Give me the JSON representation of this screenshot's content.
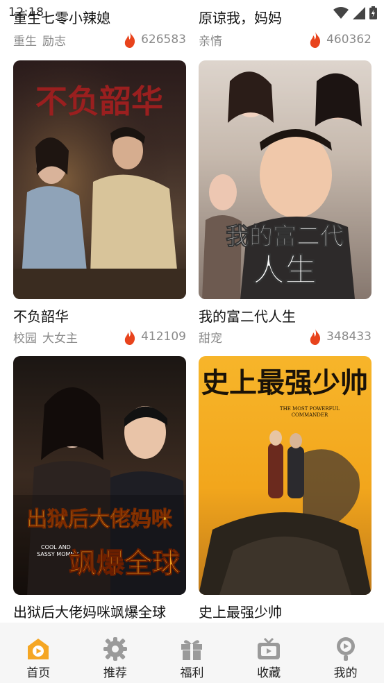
{
  "status": {
    "time": "12:18"
  },
  "cards": [
    {
      "title": "重生七零小辣媳",
      "tags": [
        "重生",
        "励志"
      ],
      "views": "626583"
    },
    {
      "title": "原谅我，妈妈",
      "tags": [
        "亲情"
      ],
      "views": "460362"
    },
    {
      "title": "不负韶华",
      "tags": [
        "校园",
        "大女主"
      ],
      "views": "412109",
      "poster_text": "不负韶华"
    },
    {
      "title": "我的富二代人生",
      "tags": [
        "甜宠"
      ],
      "views": "348433",
      "poster_text_1": "我的富二代",
      "poster_text_2": "人生"
    },
    {
      "title": "出狱后大佬妈咪飒爆全球",
      "poster_text_1": "出狱后大佬妈咪",
      "poster_text_2": "飒爆全球",
      "poster_en_1": "COOL AND",
      "poster_en_2": "SASSY MOMMY"
    },
    {
      "title": "史上最强少帅",
      "poster_text": "史上最强少帅",
      "poster_en_1": "THE MOST POWERFUL",
      "poster_en_2": "COMMANDER"
    }
  ],
  "nav": [
    {
      "label": "首页",
      "icon": "home-play-icon",
      "active": true
    },
    {
      "label": "推荐",
      "icon": "gear-icon",
      "active": false
    },
    {
      "label": "福利",
      "icon": "gift-icon",
      "active": false
    },
    {
      "label": "收藏",
      "icon": "tv-icon",
      "active": false
    },
    {
      "label": "我的",
      "icon": "profile-play-icon",
      "active": false
    }
  ],
  "colors": {
    "accent": "#f5a623",
    "flame": "#e8431c",
    "nav_bg": "#f6f6f6",
    "muted_text": "#8a8a8a"
  }
}
